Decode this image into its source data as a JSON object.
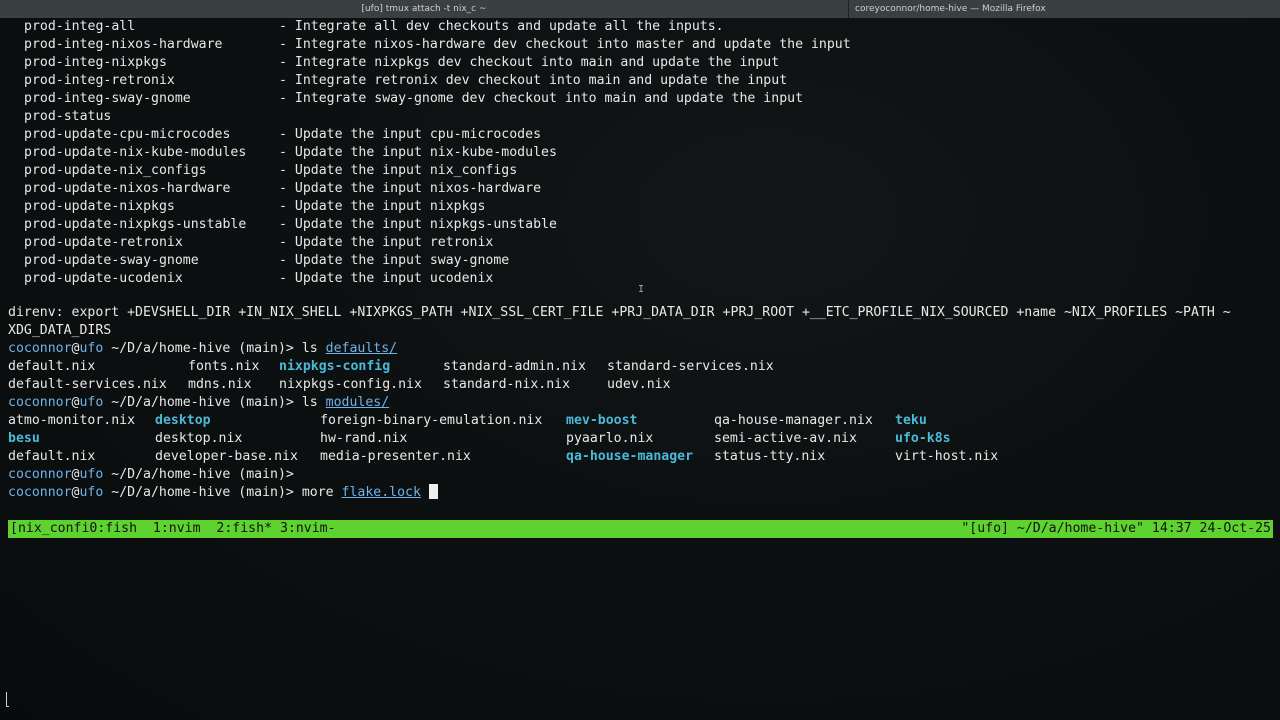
{
  "window": {
    "left_title": "[ufo] tmux attach -t nix_c ~",
    "right_title": "coreyoconnor/home-hive — Mozilla Firefox"
  },
  "targets": [
    {
      "name": "prod-integ-all",
      "desc": "- Integrate all dev checkouts and update all the inputs."
    },
    {
      "name": "prod-integ-nixos-hardware",
      "desc": "- Integrate nixos-hardware dev checkout into master and update the input"
    },
    {
      "name": "prod-integ-nixpkgs",
      "desc": "- Integrate nixpkgs dev checkout into main and update the input"
    },
    {
      "name": "prod-integ-retronix",
      "desc": "- Integrate retronix dev checkout into main and update the input"
    },
    {
      "name": "prod-integ-sway-gnome",
      "desc": "- Integrate sway-gnome dev checkout into main and update the input"
    },
    {
      "name": "prod-status",
      "desc": ""
    },
    {
      "name": "prod-update-cpu-microcodes",
      "desc": "- Update the input cpu-microcodes"
    },
    {
      "name": "prod-update-nix-kube-modules",
      "desc": "- Update the input nix-kube-modules"
    },
    {
      "name": "prod-update-nix_configs",
      "desc": "- Update the input nix_configs"
    },
    {
      "name": "prod-update-nixos-hardware",
      "desc": "- Update the input nixos-hardware"
    },
    {
      "name": "prod-update-nixpkgs",
      "desc": "- Update the input nixpkgs"
    },
    {
      "name": "prod-update-nixpkgs-unstable",
      "desc": "- Update the input nixpkgs-unstable"
    },
    {
      "name": "prod-update-retronix",
      "desc": "- Update the input retronix"
    },
    {
      "name": "prod-update-sway-gnome",
      "desc": "- Update the input sway-gnome"
    },
    {
      "name": "prod-update-ucodenix",
      "desc": "- Update the input ucodenix"
    }
  ],
  "direnv": {
    "line1": "direnv: export +DEVSHELL_DIR +IN_NIX_SHELL +NIXPKGS_PATH +NIX_SSL_CERT_FILE +PRJ_DATA_DIR +PRJ_ROOT +__ETC_PROFILE_NIX_SOURCED +name ~NIX_PROFILES ~PATH ~",
    "line2": "XDG_DATA_DIRS"
  },
  "prompt": {
    "user": "coconnor",
    "at": "@",
    "host": "ufo",
    "path": " ~/D/a/home-hive",
    "branch": " (main)> "
  },
  "cmd1": {
    "cmd": "ls ",
    "arg": "defaults/"
  },
  "ls_defaults": {
    "row1": [
      "default.nix",
      "fonts.nix",
      "nixpkgs-config",
      "standard-admin.nix",
      "standard-services.nix"
    ],
    "row2": [
      "default-services.nix",
      "mdns.nix",
      "nixpkgs-config.nix",
      "standard-nix.nix",
      "udev.nix"
    ]
  },
  "cmd2": {
    "cmd": "ls ",
    "arg": "modules/"
  },
  "ls_modules": {
    "row1": [
      "atmo-monitor.nix",
      "desktop",
      "foreign-binary-emulation.nix",
      "mev-boost",
      "qa-house-manager.nix",
      "teku"
    ],
    "row2": [
      "besu",
      "desktop.nix",
      "hw-rand.nix",
      "pyaarlo.nix",
      "semi-active-av.nix",
      "ufo-k8s"
    ],
    "row3": [
      "default.nix",
      "developer-base.nix",
      "media-presenter.nix",
      "qa-house-manager",
      "status-tty.nix",
      "virt-host.nix"
    ]
  },
  "cmd4": {
    "cmd": "more ",
    "arg": "flake.lock"
  },
  "statusbar": {
    "left": "[nix_confi0:fish  1:nvim  2:fish* 3:nvim-",
    "right": "\"[ufo] ~/D/a/home-hive\" 14:37 24-Oct-25"
  },
  "colors": {
    "status_bg": "#5ed32f",
    "prompt": "#6fb3e8",
    "dir": "#4bb9d8"
  }
}
